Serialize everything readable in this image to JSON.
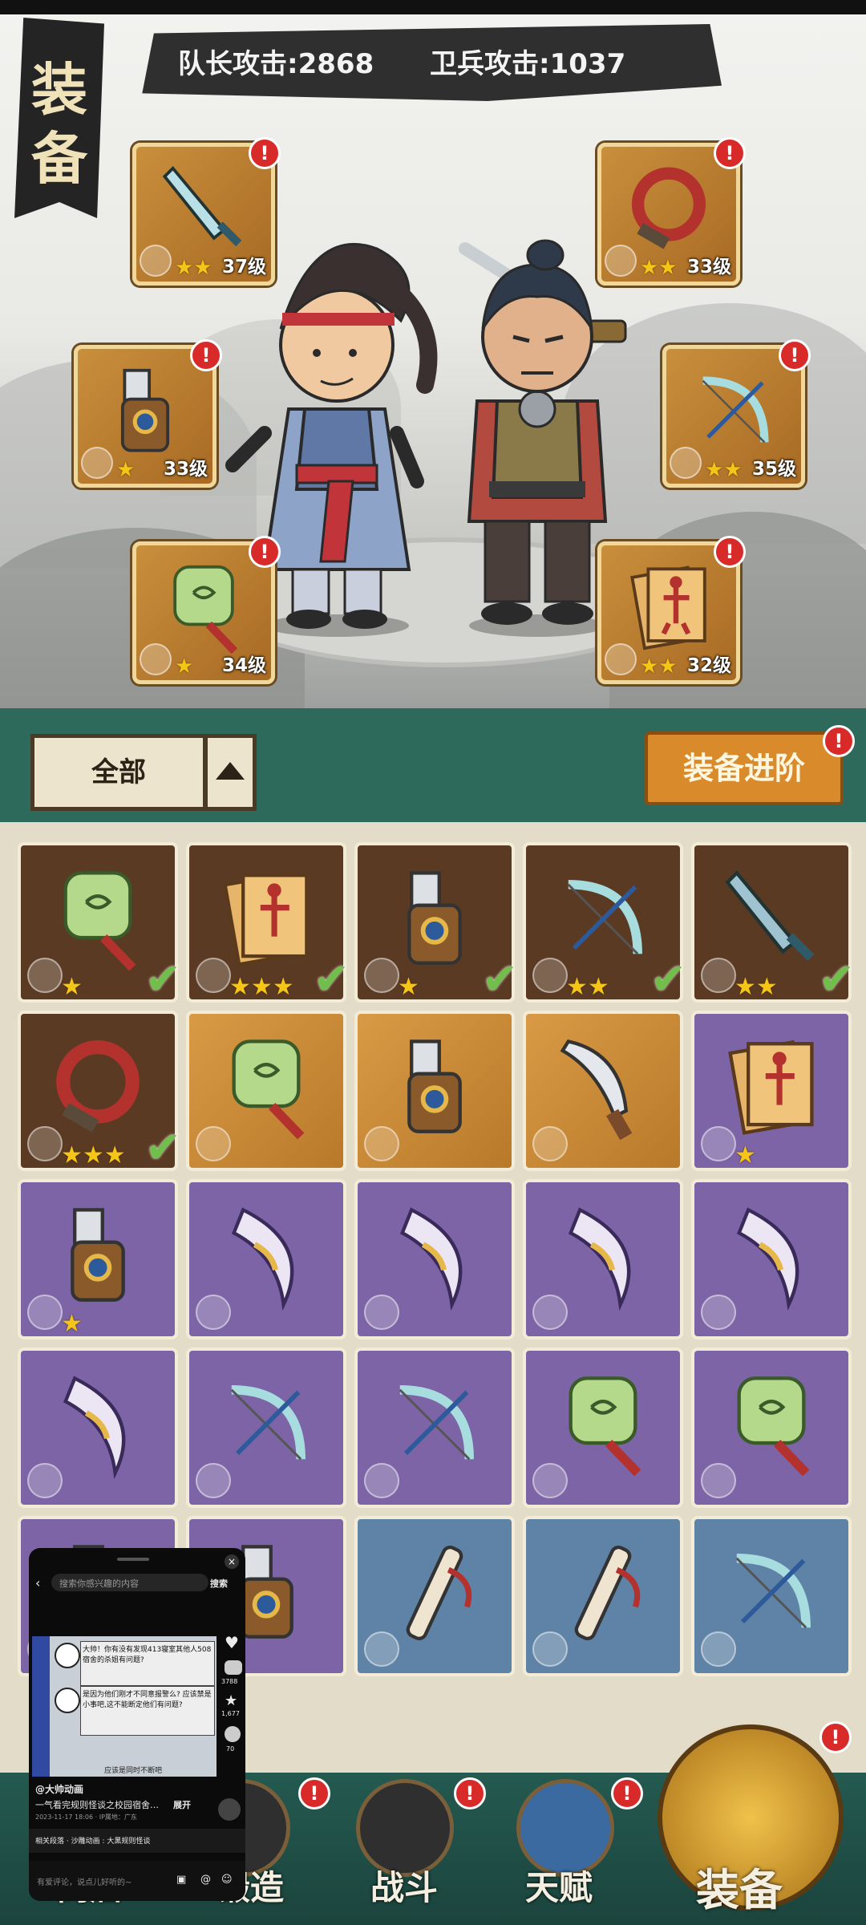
{
  "header": {
    "title_chars": [
      "装",
      "备"
    ],
    "captain_attack": "队长攻击:2868",
    "guard_attack": "卫兵攻击:1037"
  },
  "equipment_slots": [
    {
      "name": "sword",
      "level": "37级",
      "stars": "★★",
      "alert": "!"
    },
    {
      "name": "whip",
      "level": "33级",
      "stars": "★★",
      "alert": "!"
    },
    {
      "name": "gauntlet",
      "level": "33级",
      "stars": "★",
      "alert": "!"
    },
    {
      "name": "bow",
      "level": "35级",
      "stars": "★★",
      "alert": "!"
    },
    {
      "name": "jade-token",
      "level": "34级",
      "stars": "★",
      "alert": "!"
    },
    {
      "name": "scroll",
      "level": "32级",
      "stars": "★★",
      "alert": "!"
    }
  ],
  "filter": {
    "label": "全部",
    "advance_button": "装备进阶",
    "advance_alert": "!"
  },
  "inventory": {
    "check_mark": "✔",
    "rows": [
      [
        {
          "item": "jade-token",
          "rarity": "brown",
          "stars": "★",
          "checked": true
        },
        {
          "item": "scroll",
          "rarity": "brown",
          "stars": "★★★",
          "checked": true
        },
        {
          "item": "gauntlet",
          "rarity": "brown",
          "stars": "★",
          "checked": true
        },
        {
          "item": "bow",
          "rarity": "brown",
          "stars": "★★",
          "checked": true
        },
        {
          "item": "sword",
          "rarity": "brown",
          "stars": "★★",
          "checked": true
        }
      ],
      [
        {
          "item": "whip",
          "rarity": "brown",
          "stars": "★★★",
          "checked": true
        },
        {
          "item": "jade-token",
          "rarity": "orange",
          "stars": "",
          "checked": false
        },
        {
          "item": "gauntlet",
          "rarity": "orange",
          "stars": "",
          "checked": false
        },
        {
          "item": "dao",
          "rarity": "orange",
          "stars": "",
          "checked": false
        },
        {
          "item": "scroll",
          "rarity": "purple",
          "stars": "★",
          "checked": false
        }
      ],
      [
        {
          "item": "gauntlet",
          "rarity": "purple",
          "stars": "★",
          "checked": false
        },
        {
          "item": "crescent",
          "rarity": "purple",
          "stars": "",
          "checked": false
        },
        {
          "item": "crescent",
          "rarity": "purple",
          "stars": "",
          "checked": false
        },
        {
          "item": "crescent",
          "rarity": "purple",
          "stars": "",
          "checked": false
        },
        {
          "item": "crescent",
          "rarity": "purple",
          "stars": "",
          "checked": false
        }
      ],
      [
        {
          "item": "crescent",
          "rarity": "purple",
          "stars": "",
          "checked": false
        },
        {
          "item": "bow",
          "rarity": "purple",
          "stars": "",
          "checked": false
        },
        {
          "item": "bow",
          "rarity": "purple",
          "stars": "",
          "checked": false
        },
        {
          "item": "jade-token",
          "rarity": "purple",
          "stars": "",
          "checked": false
        },
        {
          "item": "jade-token",
          "rarity": "purple",
          "stars": "",
          "checked": false
        }
      ],
      [
        {
          "item": "gauntlet",
          "rarity": "purple",
          "stars": "",
          "checked": false
        },
        {
          "item": "gauntlet",
          "rarity": "purple",
          "stars": "",
          "checked": false
        },
        {
          "item": "flute",
          "rarity": "blue",
          "stars": "",
          "checked": false
        },
        {
          "item": "flute",
          "rarity": "blue",
          "stars": "",
          "checked": false
        },
        {
          "item": "bow",
          "rarity": "blue",
          "stars": "",
          "checked": false
        }
      ]
    ]
  },
  "nav": {
    "items": [
      "商店",
      "锻造",
      "战斗",
      "天赋",
      "装备"
    ],
    "alert": "!"
  },
  "video_overlay": {
    "search_placeholder": "搜索你感兴趣的内容",
    "search_button": "搜索",
    "like_icon": "♥",
    "comment_count": "3788",
    "star_count": "1,677",
    "share_count": "70",
    "bubble_1": "大帅！你有没有发现413寝室其他人508宿舍的杀姐有问题?",
    "bubble_2": "是因为他们刚才不同意报警么? 应该禁是小事吧,这不能断定他们有问题?",
    "caption_line": "应该是同时不断吧",
    "author": "@大帅动画",
    "desc": "一气看完规则怪谈之校园宿舍…",
    "expand": "展开",
    "meta": "2023-11-17 18:06 · IP属地：广东",
    "related": "相关段落 · 沙雕动画 : 大黑规则怪谈",
    "comment_placeholder": "有爱评论，说点儿好听的~"
  },
  "colors": {
    "scene_bg": "#e9e9e5",
    "filter_bar": "#2e6a5c",
    "gold_slot": "#c98f3c",
    "purple_cell": "#7c64a6",
    "blue_cell": "#5f83a6",
    "brown_cell": "#5a3a22",
    "alert_red": "#d92a2a",
    "check_green": "#6fbf4a"
  }
}
